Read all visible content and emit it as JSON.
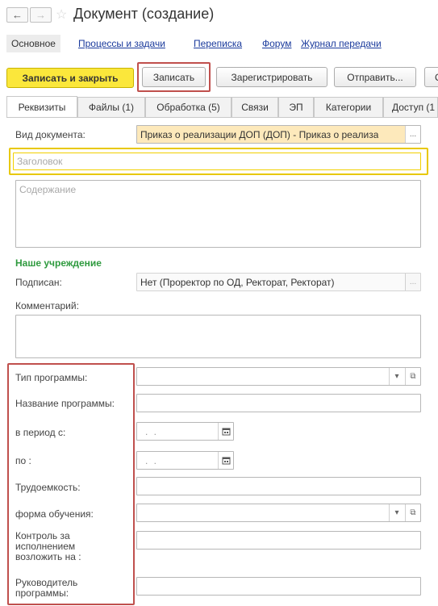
{
  "header": {
    "back_icon": "arrow-left-icon",
    "forward_icon": "arrow-right-icon",
    "favorite_icon": "star-icon",
    "title": "Документ (создание)"
  },
  "subnav": {
    "items": [
      {
        "label": "Основное"
      },
      {
        "label": "Процессы и задачи"
      },
      {
        "label": "Переписка"
      },
      {
        "label": "Форум"
      },
      {
        "label": "Журнал передачи"
      }
    ]
  },
  "toolbar": {
    "save_close": "Записать и закрыть",
    "save": "Записать",
    "register": "Зарегистрировать",
    "send": "Отправить...",
    "more": "С"
  },
  "tabs": [
    {
      "label": "Реквизиты"
    },
    {
      "label": "Файлы (1)"
    },
    {
      "label": "Обработка (5)"
    },
    {
      "label": "Связи"
    },
    {
      "label": "ЭП"
    },
    {
      "label": "Категории"
    },
    {
      "label": "Доступ (1"
    }
  ],
  "form": {
    "doc_type_label": "Вид документа:",
    "doc_type_value": "Приказ о реализации ДОП (ДОП) - Приказ о реализа",
    "title_placeholder": "Заголовок",
    "content_placeholder": "Содержание",
    "section_title": "Наше учреждение",
    "signed_label": "Подписан:",
    "signed_value": "Нет (Проректор по ОД, Ректорат, Ректорат)",
    "comment_label": "Комментарий:",
    "program_type_label": "Тип программы:",
    "program_name_label": "Название программы:",
    "period_from_label": "в период с:",
    "period_to_label": "по :",
    "date_placeholder": ". .",
    "labor_label": "Трудоемкость:",
    "study_form_label": "форма обучения:",
    "control_label": "Контроль за исполнением возложить на :",
    "head_label": "Руководитель программы:",
    "ellipsis": "...",
    "dropdown_glyph": "▾",
    "open_glyph": "⧉"
  },
  "colors": {
    "primary_button": "#fbe73b",
    "highlight_frame": "#c0504d",
    "title_frame": "#e8c800",
    "section_title": "#2e9a3e",
    "doc_type_bg": "#fde9bb"
  }
}
